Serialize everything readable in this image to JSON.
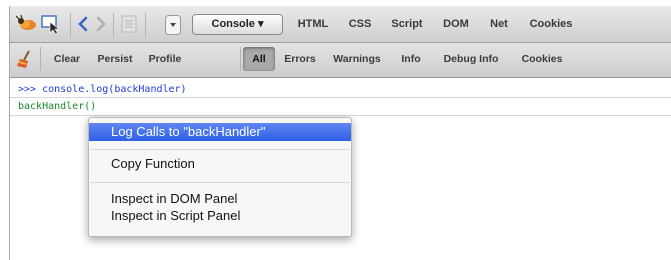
{
  "toolbar": {
    "panel_select_label": "Console ▾",
    "tabs": [
      "HTML",
      "CSS",
      "Script",
      "DOM",
      "Net",
      "Cookies"
    ]
  },
  "filter_bar": {
    "clear": "Clear",
    "persist": "Persist",
    "profile": "Profile",
    "all": "All",
    "errors": "Errors",
    "warnings": "Warnings",
    "info": "Info",
    "debug_info": "Debug Info",
    "cookies": "Cookies"
  },
  "console": {
    "command": ">>> console.log(backHandler)",
    "output": "backHandler()"
  },
  "context_menu": {
    "items": [
      "Log Calls to \"backHandler\"",
      "Copy Function",
      "Inspect in DOM Panel",
      "Inspect in Script Panel"
    ]
  },
  "colors": {
    "command_blue": "#1f3cd6",
    "output_green": "#1c8a2a",
    "menu_highlight": "#2d5fe7"
  }
}
